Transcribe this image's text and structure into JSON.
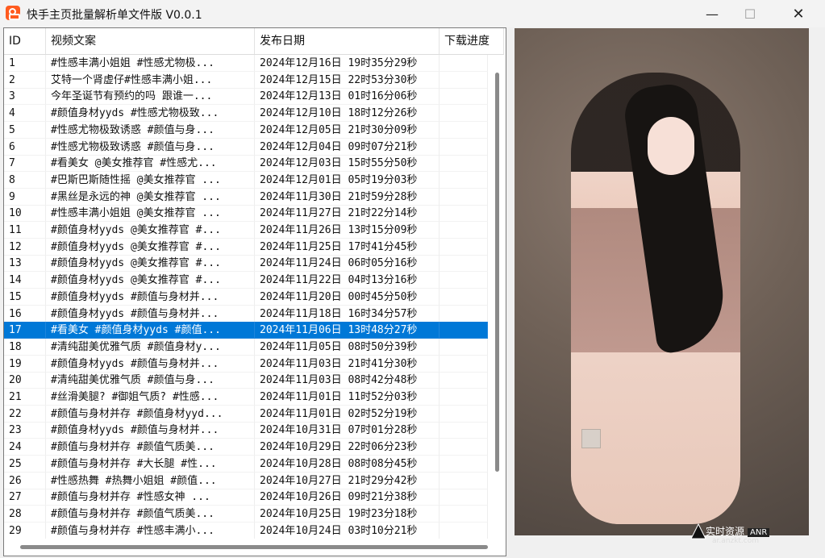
{
  "window": {
    "title": "快手主页批量解析单文件版 V0.0.1",
    "controls": {
      "minimize": "—",
      "maximize": "☐",
      "close": "✕"
    }
  },
  "table": {
    "headers": [
      "ID",
      "视频文案",
      "发布日期",
      "下载进度"
    ],
    "rows": [
      [
        "1",
        "#性感丰满小姐姐 #性感尤物极...",
        "2024年12月16日 19时35分29秒",
        ""
      ],
      [
        "2",
        "艾特一个肾虚仔#性感丰满小姐...",
        "2024年12月15日 22时53分30秒",
        ""
      ],
      [
        "3",
        "今年圣诞节有预约的吗 跟谁一...",
        "2024年12月13日 01时16分06秒",
        ""
      ],
      [
        "4",
        "#颜值身材yyds  #性感尤物极致...",
        "2024年12月10日 18时12分26秒",
        ""
      ],
      [
        "5",
        "#性感尤物极致诱惑 #颜值与身...",
        "2024年12月05日 21时30分09秒",
        ""
      ],
      [
        "6",
        "#性感尤物极致诱惑 #颜值与身...",
        "2024年12月04日 09时07分21秒",
        ""
      ],
      [
        "7",
        "#看美女 @美女推荐官  #性感尤...",
        "2024年12月03日 15时55分50秒",
        ""
      ],
      [
        "8",
        "#巴斯巴斯随性摇 @美女推荐官 ...",
        "2024年12月01日 05时19分03秒",
        ""
      ],
      [
        "9",
        "#黑丝是永远的神 @美女推荐官 ...",
        "2024年11月30日 21时59分28秒",
        ""
      ],
      [
        "10",
        "#性感丰满小姐姐 @美女推荐官 ...",
        "2024年11月27日 21时22分14秒",
        ""
      ],
      [
        "11",
        "#颜值身材yyds @美女推荐官 #...",
        "2024年11月26日 13时15分09秒",
        ""
      ],
      [
        "12",
        "#颜值身材yyds @美女推荐官  #...",
        "2024年11月25日 17时41分45秒",
        ""
      ],
      [
        "13",
        "#颜值身材yyds @美女推荐官  #...",
        "2024年11月24日 06时05分16秒",
        ""
      ],
      [
        "14",
        "#颜值身材yyds @美女推荐官 #...",
        "2024年11月22日 04时13分16秒",
        ""
      ],
      [
        "15",
        "#颜值身材yyds #颜值与身材并...",
        "2024年11月20日 00时45分50秒",
        ""
      ],
      [
        "16",
        "#颜值身材yyds  #颜值与身材并...",
        "2024年11月18日 16时34分57秒",
        ""
      ],
      [
        "17",
        "#看美女 #颜值身材yyds #颜值...",
        "2024年11月06日 13时48分27秒",
        ""
      ],
      [
        "18",
        "#清纯甜美优雅气质 #颜值身材y...",
        "2024年11月05日 08时50分39秒",
        ""
      ],
      [
        "19",
        "#颜值身材yyds #颜值与身材并...",
        "2024年11月03日 21时41分30秒",
        ""
      ],
      [
        "20",
        "#清纯甜美优雅气质  #颜值与身...",
        "2024年11月03日 08时42分48秒",
        ""
      ],
      [
        "21",
        "#丝滑美腿? #御姐气质? #性感...",
        "2024年11月01日 11时52分03秒",
        ""
      ],
      [
        "22",
        "#颜值与身材并存 #颜值身材yyd...",
        "2024年11月01日 02时52分19秒",
        ""
      ],
      [
        "23",
        "#颜值身材yyds #颜值与身材并...",
        "2024年10月31日 07时01分28秒",
        ""
      ],
      [
        "24",
        "#颜值与身材并存 #颜值气质美...",
        "2024年10月29日 22时06分23秒",
        ""
      ],
      [
        "25",
        "#颜值与身材并存 #大长腿 #性...",
        "2024年10月28日 08时08分45秒",
        ""
      ],
      [
        "26",
        "#性感热舞 #热舞小姐姐 #颜值...",
        "2024年10月27日 21时29分42秒",
        ""
      ],
      [
        "27",
        "#颜值与身材并存 #性感女神 ...",
        "2024年10月26日 09时21分38秒",
        ""
      ],
      [
        "28",
        "#颜值与身材并存 #颜值气质美...",
        "2024年10月25日 19时23分18秒",
        ""
      ],
      [
        "29",
        "#颜值与身材并存 #性感丰满小...",
        "2024年10月24日 03时10分21秒",
        ""
      ]
    ],
    "selected_row_index": 16
  },
  "watermark": {
    "text": "实时资源",
    "brand": "ANR",
    "url": "ar.anzkt.com"
  },
  "colors": {
    "selection": "#0078d7",
    "title_bg": "#f3f3f3",
    "app_icon": "#ff5b1f"
  }
}
